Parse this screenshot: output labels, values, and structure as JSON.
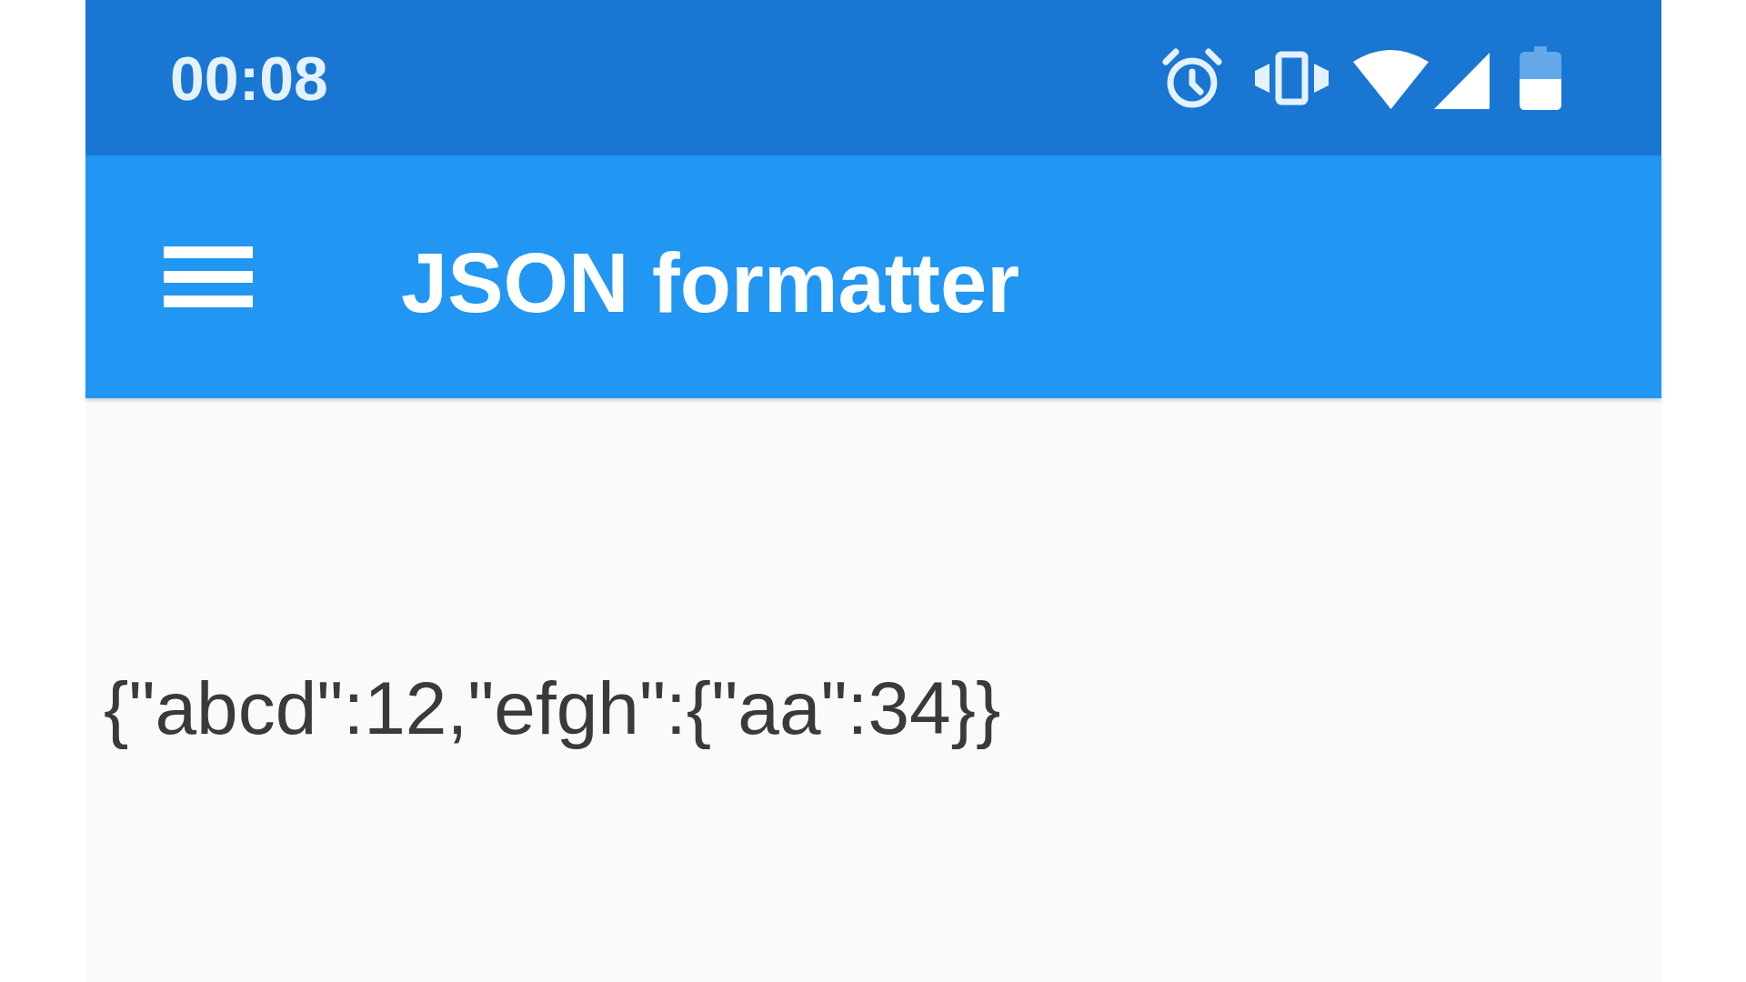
{
  "status_bar": {
    "time": "00:08"
  },
  "app_bar": {
    "title": "JSON formatter"
  },
  "content": {
    "text": "{\"abcd\":12,\"efgh\":{\"aa\":34}}"
  }
}
